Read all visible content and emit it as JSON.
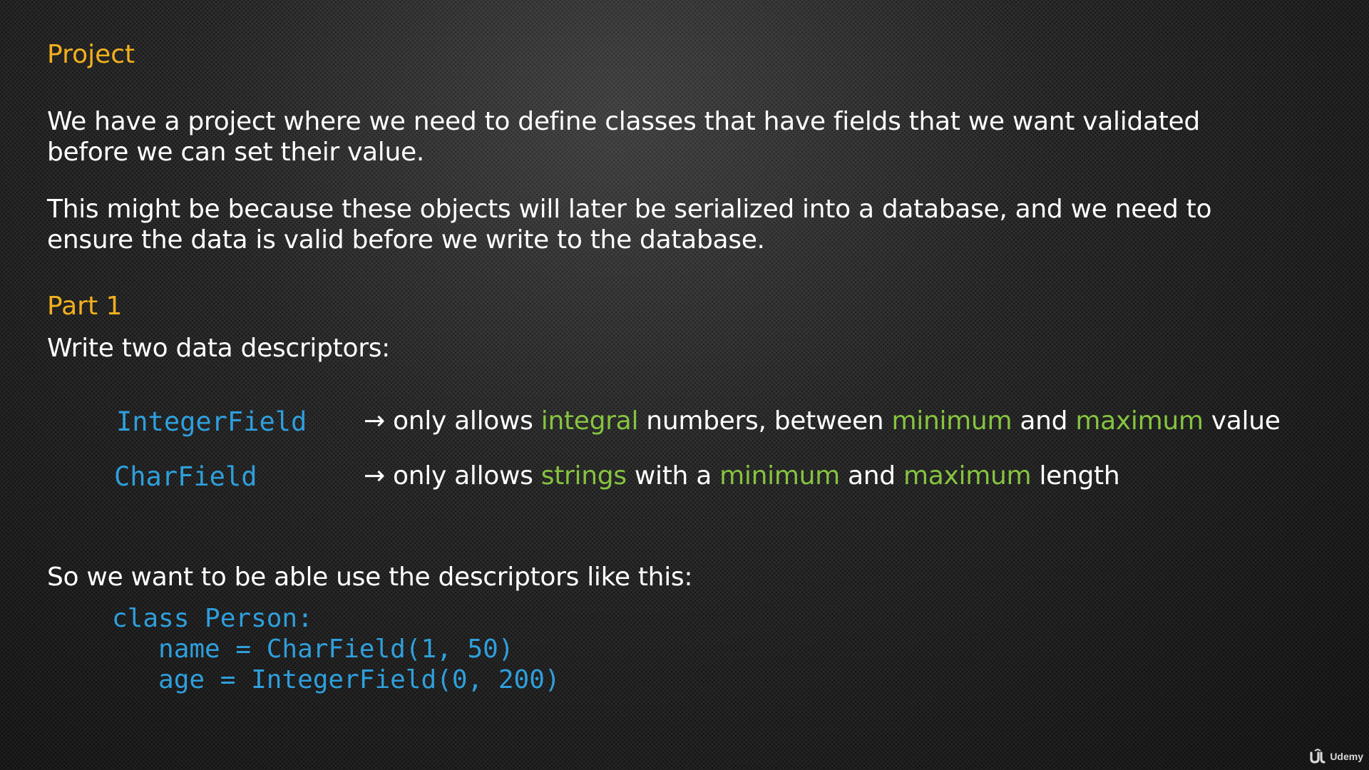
{
  "slide": {
    "project_heading": "Project",
    "intro_paragraph_1": "We have a project where we need to define classes that have fields that we want validated before we can set their value.",
    "intro_paragraph_2": "This might be because these objects will later be serialized into a database, and we need to ensure the data is valid before we write to the database.",
    "part_heading": "Part 1",
    "part_instruction": "Write two data descriptors:",
    "descriptors": [
      {
        "name": "IntegerField",
        "arrow": "→",
        "segments": [
          {
            "text": " only allows ",
            "highlight": false
          },
          {
            "text": "integral",
            "highlight": true
          },
          {
            "text": " numbers, between ",
            "highlight": false
          },
          {
            "text": "minimum",
            "highlight": true
          },
          {
            "text": " and ",
            "highlight": false
          },
          {
            "text": "maximum",
            "highlight": true
          },
          {
            "text": " value",
            "highlight": false
          }
        ]
      },
      {
        "name": "CharField",
        "arrow": "→",
        "segments": [
          {
            "text": " only allows ",
            "highlight": false
          },
          {
            "text": "strings",
            "highlight": true
          },
          {
            "text": " with a ",
            "highlight": false
          },
          {
            "text": "minimum",
            "highlight": true
          },
          {
            "text": " and ",
            "highlight": false
          },
          {
            "text": "maximum",
            "highlight": true
          },
          {
            "text": " length",
            "highlight": false
          }
        ]
      }
    ],
    "usage_intro": "So we want to be able use the descriptors like this:",
    "code_lines": [
      "class Person:",
      "   name = CharField(1, 50)",
      "   age = IntegerField(0, 200)"
    ]
  },
  "branding": {
    "logo_icon": "udemy-icon",
    "logo_text": "Udemy"
  },
  "colors": {
    "heading": "#f2b01e",
    "code": "#2f9fdc",
    "highlight": "#86c440",
    "text": "#ffffff"
  }
}
